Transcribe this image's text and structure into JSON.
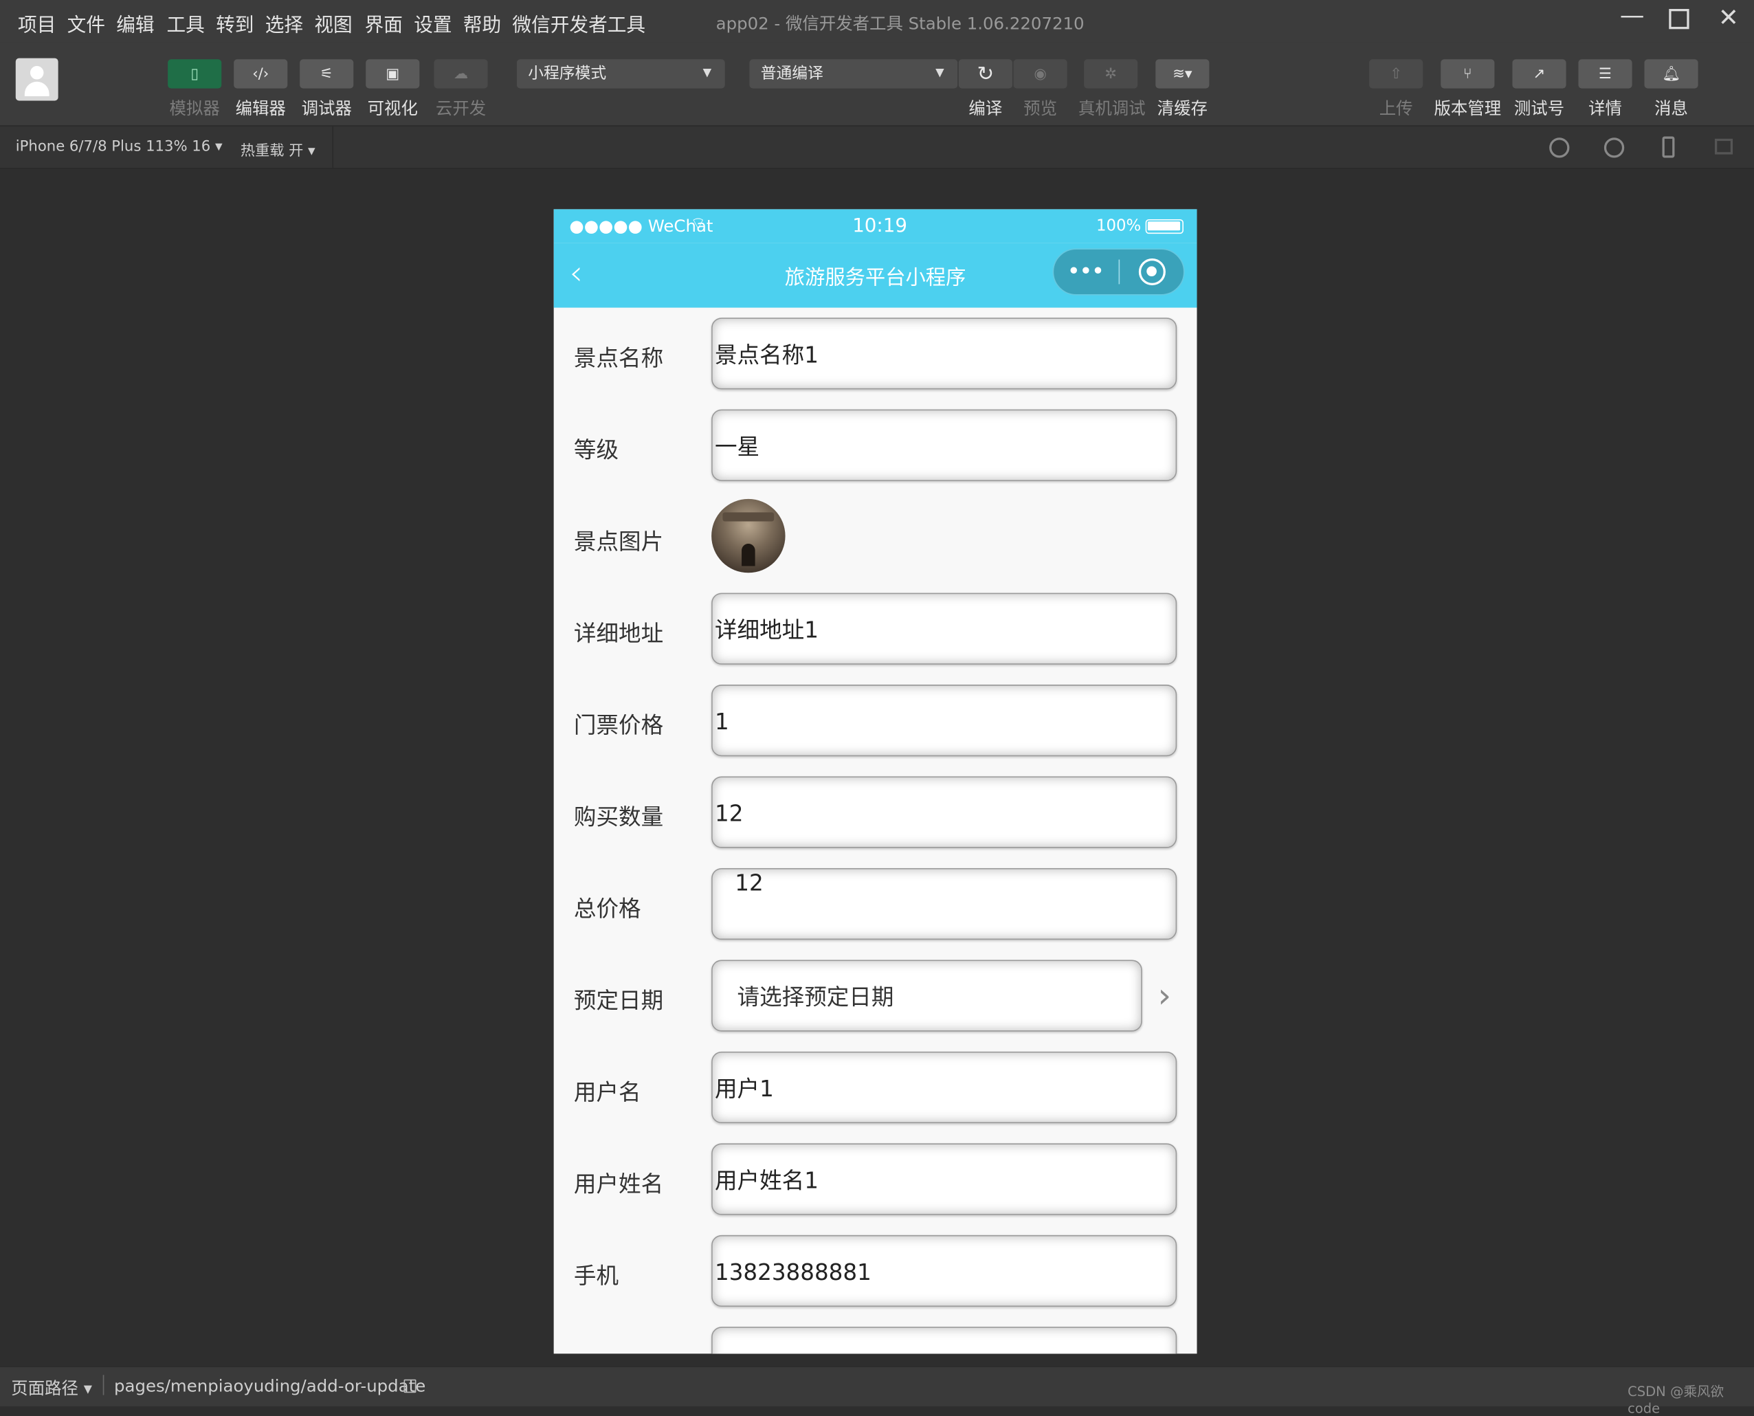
{
  "menu": [
    "项目",
    "文件",
    "编辑",
    "工具",
    "转到",
    "选择",
    "视图",
    "界面",
    "设置",
    "帮助",
    "微信开发者工具"
  ],
  "window_title": "app02 - 微信开发者工具 Stable 1.06.2207210",
  "toolbar": {
    "left_labels": [
      "模拟器",
      "编辑器",
      "调试器",
      "可视化",
      "云开发"
    ],
    "mode_select": "小程序模式",
    "compile_select": "普通编译",
    "mid_labels": [
      "编译",
      "预览",
      "真机调试",
      "清缓存"
    ],
    "right_labels": [
      "上传",
      "版本管理",
      "测试号",
      "详情",
      "消息"
    ]
  },
  "subbar": {
    "device": "iPhone 6/7/8 Plus 113% 16",
    "hot_reload": "热重载 开"
  },
  "phone": {
    "status_left": "●●●●● WeChat",
    "status_time": "10:19",
    "status_battery": "100%",
    "nav_title": "旅游服务平台小程序",
    "form": [
      {
        "label": "景点名称",
        "value": "景点名称1"
      },
      {
        "label": "等级",
        "value": "一星"
      },
      {
        "label": "景点图片",
        "value": ""
      },
      {
        "label": "详细地址",
        "value": "详细地址1"
      },
      {
        "label": "门票价格",
        "value": "1"
      },
      {
        "label": "购买数量",
        "value": "12"
      },
      {
        "label": "总价格",
        "value": "12"
      },
      {
        "label": "预定日期",
        "value": "请选择预定日期"
      },
      {
        "label": "用户名",
        "value": "用户1"
      },
      {
        "label": "用户姓名",
        "value": "用户姓名1"
      },
      {
        "label": "手机",
        "value": "13823888881"
      }
    ]
  },
  "bottombar": {
    "path_label": "页面路径",
    "path": "pages/menpiaoyuding/add-or-update",
    "watermark": "CSDN @乘风欲code"
  },
  "colors": {
    "nav": "#4cd0ef",
    "green_btn": "#1f6e47",
    "bg": "#2e2e2e"
  }
}
